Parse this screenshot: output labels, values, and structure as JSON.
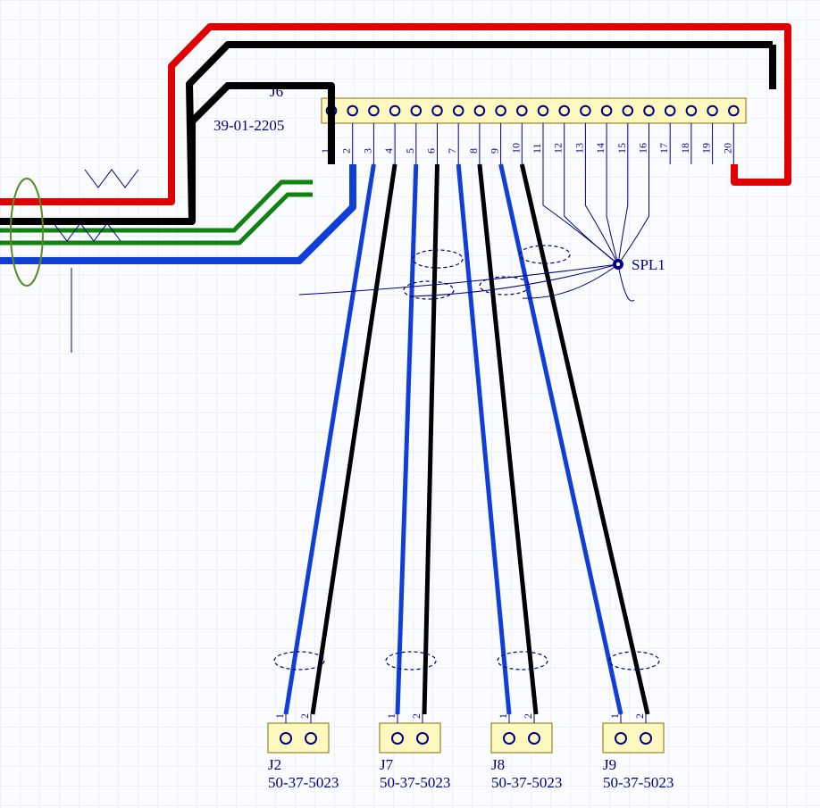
{
  "j6": {
    "ref": "J6",
    "pn": "39-01-2205",
    "pins": [
      "1",
      "2",
      "3",
      "4",
      "5",
      "6",
      "7",
      "8",
      "9",
      "10",
      "11",
      "12",
      "13",
      "14",
      "15",
      "16",
      "17",
      "18",
      "19",
      "20"
    ]
  },
  "splice": {
    "ref": "SPL1"
  },
  "bottom": [
    {
      "ref": "J2",
      "pn": "50-37-5023",
      "pins": [
        "1",
        "2"
      ]
    },
    {
      "ref": "J7",
      "pn": "50-37-5023",
      "pins": [
        "1",
        "2"
      ]
    },
    {
      "ref": "J8",
      "pn": "50-37-5023",
      "pins": [
        "1",
        "2"
      ]
    },
    {
      "ref": "J9",
      "pn": "50-37-5023",
      "pins": [
        "1",
        "2"
      ]
    }
  ]
}
